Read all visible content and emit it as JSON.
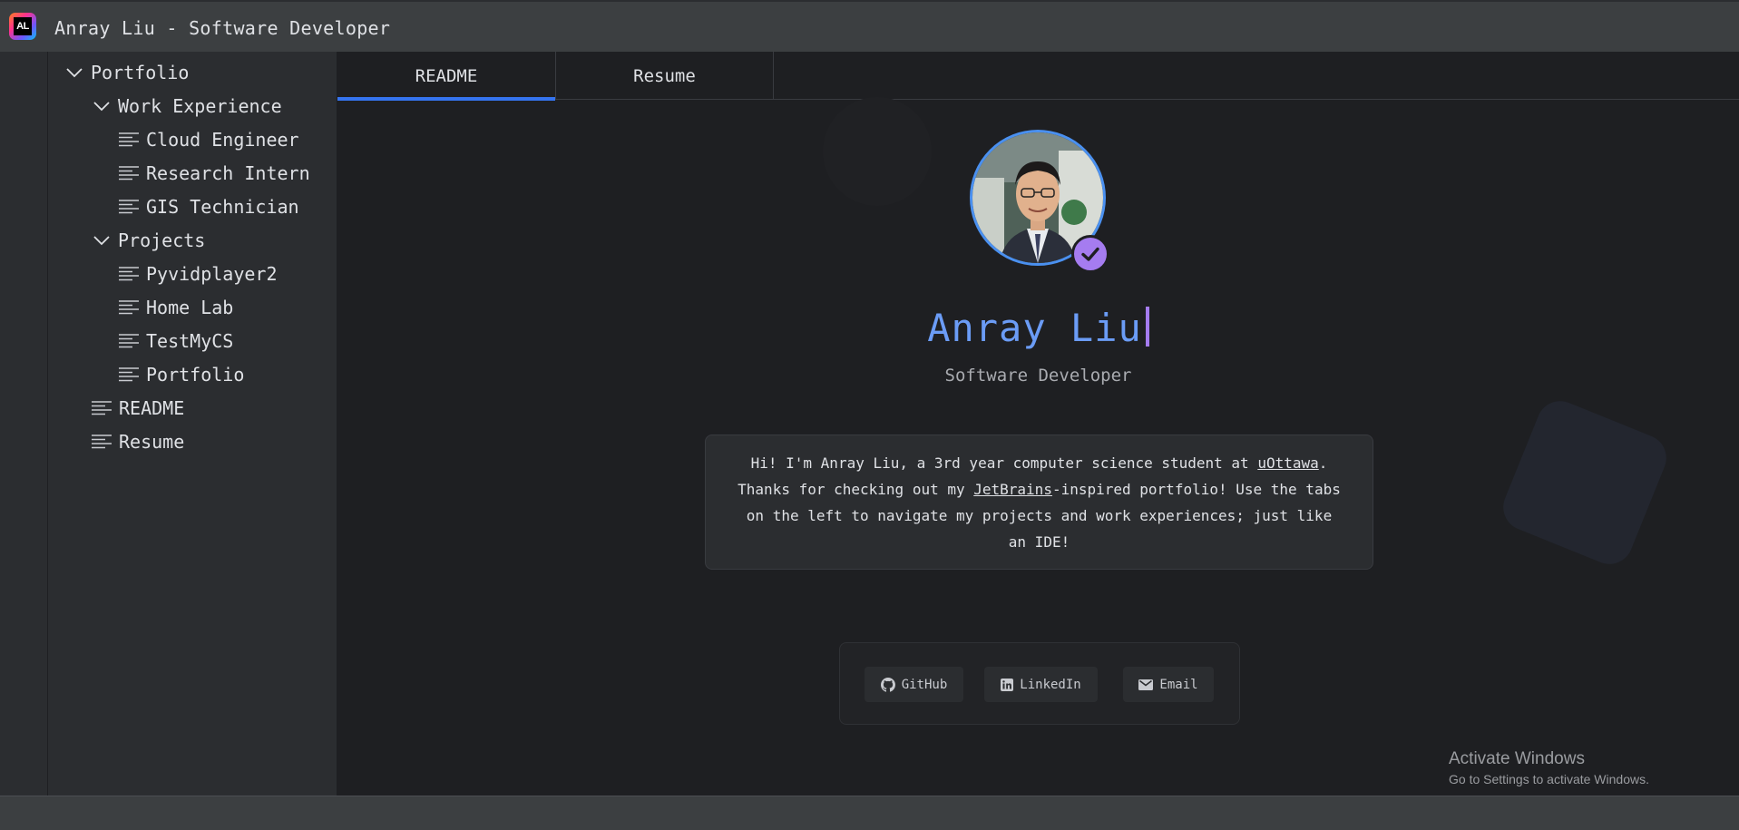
{
  "window": {
    "title": "Anray Liu - Software Developer",
    "logo_text": "AL"
  },
  "tree": {
    "root": "Portfolio",
    "work_experience": {
      "label": "Work Experience",
      "items": [
        "Cloud Engineer",
        "Research Intern",
        "GIS Technician"
      ]
    },
    "projects": {
      "label": "Projects",
      "items": [
        "Pyvidplayer2",
        "Home Lab",
        "TestMyCS",
        "Portfolio"
      ]
    },
    "files": [
      "README",
      "Resume"
    ]
  },
  "tabs": [
    {
      "label": "README",
      "active": true
    },
    {
      "label": "Resume",
      "active": false
    }
  ],
  "profile": {
    "name": "Anray Liu",
    "role": "Software Developer",
    "verified_icon": "check-circle-icon"
  },
  "intro": {
    "part1": "Hi! I'm Anray Liu, a 3rd year computer science student at ",
    "link1": "uOttawa",
    "part2": ". Thanks for checking out my ",
    "link2": "JetBrains",
    "part3": "-inspired portfolio! Use the tabs on the left to navigate my projects and work experiences; just like an IDE!"
  },
  "links": {
    "github": "GitHub",
    "linkedin": "LinkedIn",
    "email": "Email"
  },
  "watermark": {
    "line1": "Activate Windows",
    "line2": "Go to Settings to activate Windows."
  },
  "colors": {
    "accent": "#3574f0",
    "name": "#6b9cf6",
    "verified": "#a57cf0",
    "background": "#1e1f22",
    "panel": "#2b2d30"
  }
}
